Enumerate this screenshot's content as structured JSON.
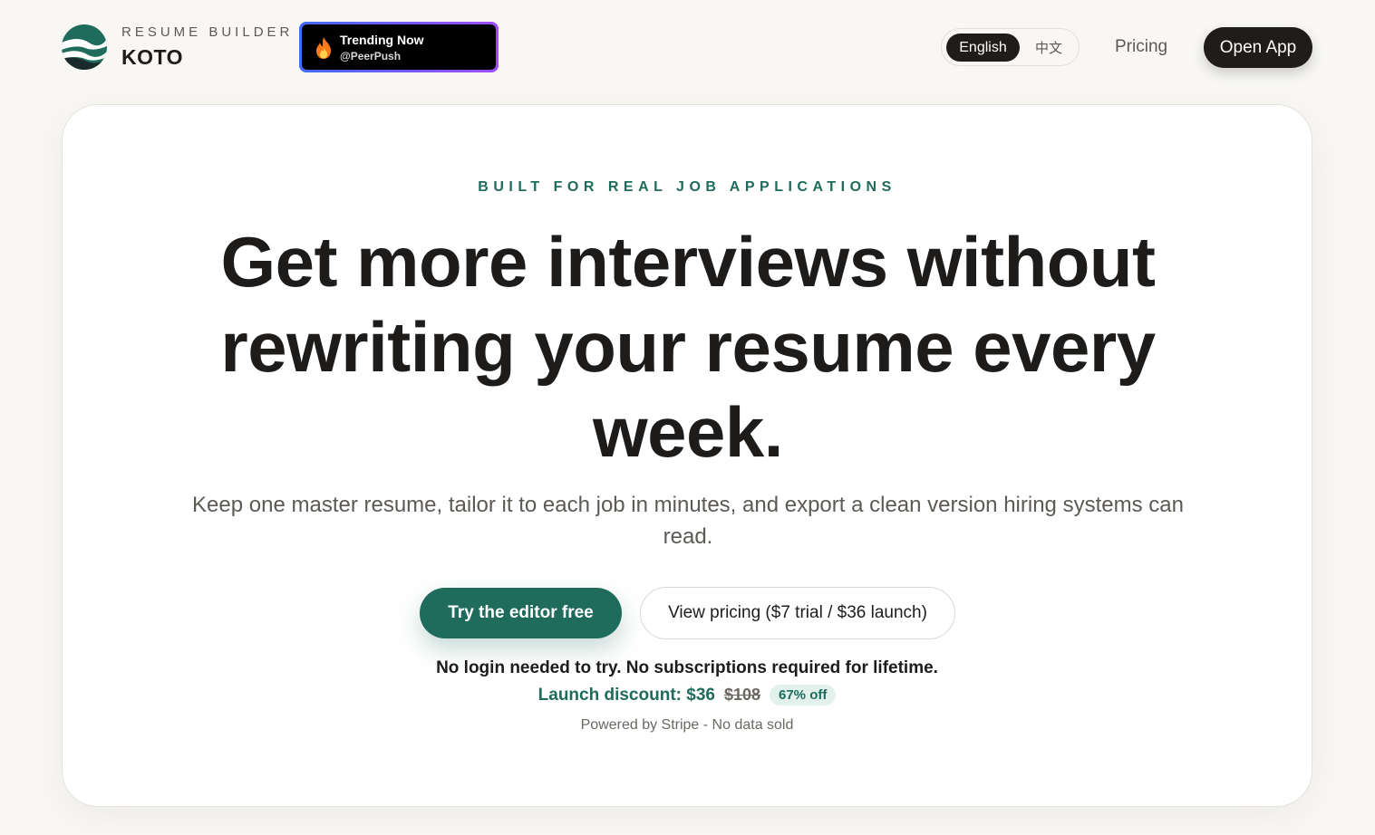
{
  "brand": {
    "kicker": "RESUME BUILDER",
    "name": "KOTO",
    "accent": "#1f6b5c"
  },
  "badge": {
    "title": "Trending Now",
    "handle": "@PeerPush",
    "icon": "fire-icon"
  },
  "nav": {
    "languages": [
      {
        "label": "English",
        "active": true
      },
      {
        "label": "中文",
        "active": false
      }
    ],
    "pricing_label": "Pricing",
    "open_app_label": "Open App"
  },
  "hero": {
    "kicker": "BUILT FOR REAL JOB APPLICATIONS",
    "headline": "Get more interviews without rewriting your resume every week.",
    "subhead": "Keep one master resume, tailor it to each job in minutes, and export a clean version hiring systems can read.",
    "primary_cta": "Try the editor free",
    "secondary_cta": "View pricing ($7 trial / $36 launch)",
    "note": "No login needed to try. No subscriptions required for lifetime.",
    "discount_label": "Launch discount: $36",
    "old_price": "$108",
    "off_badge": "67% off",
    "powered_by": "Powered by Stripe - No data sold"
  }
}
